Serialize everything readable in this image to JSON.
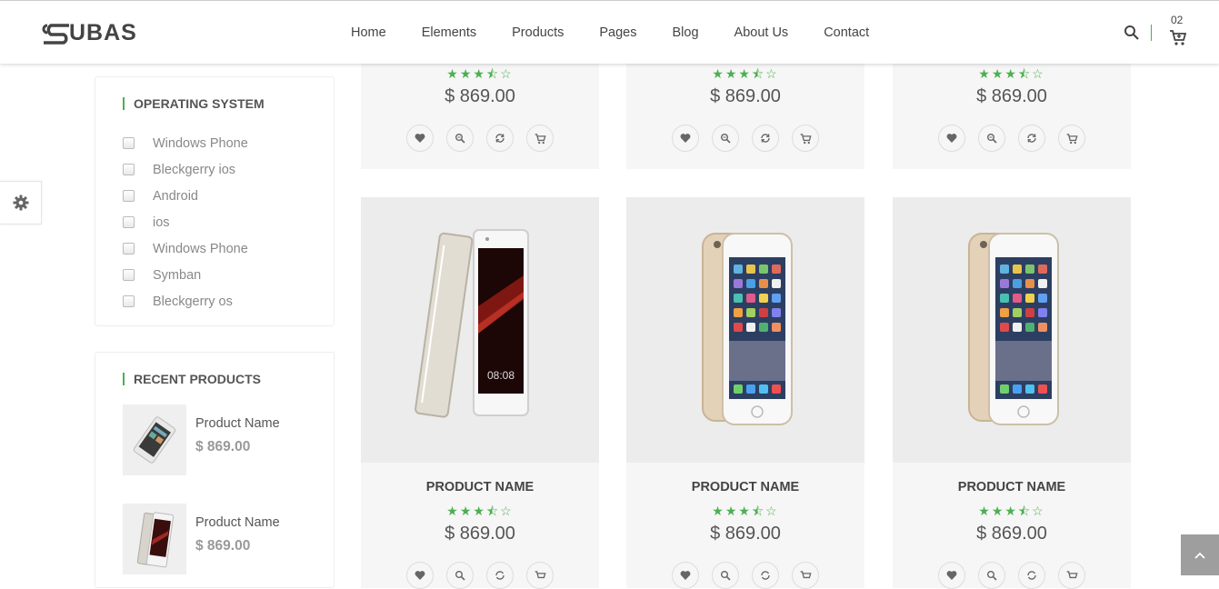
{
  "header": {
    "logo_text": "UBAS",
    "nav": [
      "Home",
      "Elements",
      "Products",
      "Pages",
      "Blog",
      "About Us",
      "Contact"
    ],
    "cart_count": "02",
    "icons": [
      "search-icon",
      "cart-icon"
    ]
  },
  "settings": {
    "icon": "gear-icon"
  },
  "sidebar": {
    "operating_system": {
      "title": "OPERATING SYSTEM",
      "items": [
        "Windows Phone",
        "Bleckgerry ios",
        "Android",
        "ios",
        "Windows Phone",
        "Symban",
        "Bleckgerry os"
      ]
    },
    "recent_products": {
      "title": "RECENT PRODUCTS",
      "items": [
        {
          "name": "Product Name",
          "price": "$ 869.00"
        },
        {
          "name": "Product Name",
          "price": "$ 869.00"
        }
      ]
    }
  },
  "products": {
    "top_row": [
      {
        "stars": "★★★⯪☆",
        "price": "$ 869.00"
      },
      {
        "stars": "★★★⯪☆",
        "price": "$ 869.00"
      },
      {
        "stars": "★★★⯪☆",
        "price": "$ 869.00"
      }
    ],
    "bottom_row": [
      {
        "name": "PRODUCT NAME",
        "stars": "★★★⯪☆",
        "price": "$ 869.00"
      },
      {
        "name": "PRODUCT NAME",
        "stars": "★★★⯪☆",
        "price": "$ 869.00"
      },
      {
        "name": "PRODUCT NAME",
        "stars": "★★★⯪☆",
        "price": "$ 869.00"
      }
    ],
    "rating": 3.5,
    "action_icons": [
      "heart-icon",
      "zoom-icon",
      "compare-icon",
      "add-to-cart-icon"
    ]
  },
  "colors": {
    "accent": "#4caf50",
    "card_bg": "#f6f6f6",
    "scroll_top_bg": "#9e9e9e"
  }
}
